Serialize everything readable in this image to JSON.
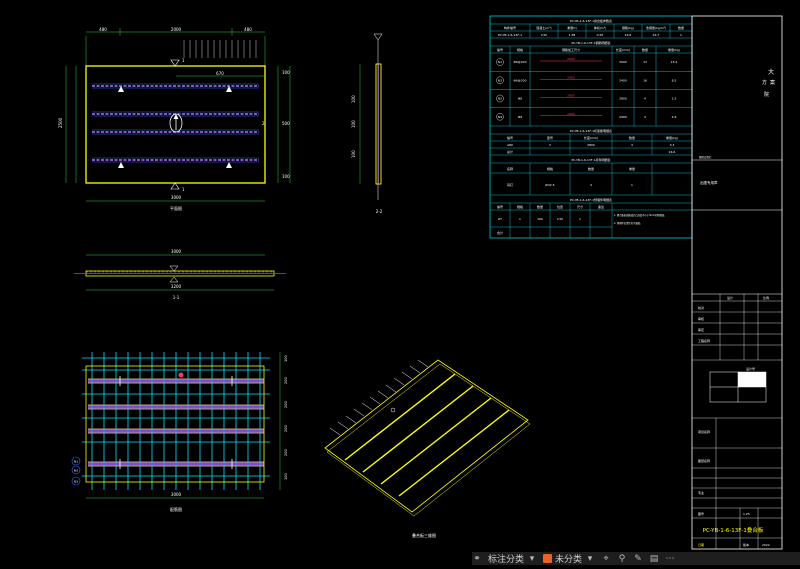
{
  "drawing": {
    "plan_title": "平面图",
    "plan_dims_top": [
      "480",
      "2000",
      "480"
    ],
    "plan_dim_inner": "670",
    "plan_dim_bottom": "3000",
    "plan_dim_right": [
      "100",
      "500",
      "100"
    ],
    "plan_dim_left": "2500",
    "section_1": "1",
    "section_2": "2",
    "side_title": "2-2",
    "side_dims": [
      "100",
      "100",
      "100"
    ],
    "elev_dim_top": "3000",
    "elev_dim_bottom": "3200",
    "elev_title": "1-1",
    "rebar_title": "配筋图",
    "rebar_dim_bottom": "3000",
    "rebar_dims_right": [
      "100",
      "200",
      "200",
      "200",
      "200",
      "100"
    ],
    "rebar_markers": [
      "N1",
      "N2",
      "N3"
    ],
    "rebar_tag": "N4",
    "iso_title": "叠合板三维图"
  },
  "schedule": {
    "t1_title": "PC-YB-1-6-13F-1叠合板参数表",
    "t1_headers": [
      "构件编号",
      "混凝土(m³)",
      "重量(t)",
      "体积(m³)",
      "钢筋(kg)",
      "含钢量(kg/m³)",
      "数量"
    ],
    "t1_row": [
      "PC-YB-1-6-13F-1",
      "C30",
      "1.38",
      "0.55",
      "24.6",
      "44.7",
      "1"
    ],
    "t2_title": "PC-YB-1-6-13F-1钢筋明细表",
    "t2_headers": [
      "编号",
      "规格",
      "钢筋加工尺寸",
      "长度(mm)",
      "数量",
      "重量(kg)"
    ],
    "t2_rows": [
      {
        "no": "N1",
        "spec": "Φ8@200",
        "dim": "2900",
        "len": "3000",
        "qty": "13",
        "wt": "15.4"
      },
      {
        "no": "N2",
        "spec": "Φ6@200",
        "dim": "2400",
        "len": "2400",
        "qty": "16",
        "wt": "8.5"
      },
      {
        "no": "N3",
        "spec": "Φ6",
        "dim": "2800",
        "len": "2800",
        "qty": "4",
        "wt": "2.5"
      },
      {
        "no": "N4",
        "spec": "Φ8",
        "dim": "2900",
        "len": "2900",
        "qty": "4",
        "wt": "4.6"
      }
    ],
    "t3_title": "PC-YB-1-6-13F-1桁架筋明细表",
    "t3_headers": [
      "编号",
      "型号",
      "长度(mm)",
      "数量",
      "重量(kg)"
    ],
    "t3_rows": [
      [
        "A80",
        "3",
        "2800",
        "3",
        "3.3"
      ],
      [
        "总计",
        "",
        "",
        "",
        "24.6"
      ]
    ],
    "t4_title": "PC-YB-1-6-13F-1吊件明细表",
    "t4_headers": [
      "名称",
      "规格",
      "数量",
      "重量"
    ],
    "t4_row": [
      "吊钉",
      "RD2.5",
      "4",
      "1"
    ],
    "t5_title": "PC-YB-1-6-13F-1预埋件明细表",
    "t5_headers": [
      "编号",
      "规格",
      "数量",
      "位置",
      "尺寸",
      "备注"
    ],
    "t5_rows": [
      [
        "ZT",
        "1",
        "100",
        "C30",
        "1",
        "1. 叠合板表面做成凹凸深度不小于4mm的粗糙面。"
      ],
      [
        "合计",
        "",
        "",
        "",
        "",
        "2. 预埋件位置详见平面图。"
      ]
    ]
  },
  "titleblock": {
    "company_lines": [
      "大",
      "方",
      "案",
      "院"
    ],
    "note": "图纸会签栏",
    "stamp": "出图专用章",
    "rows": [
      "设计",
      "校对",
      "审核",
      "审定",
      "工程名称",
      "项目名称",
      "图纸名称",
      "专业"
    ],
    "right_label": "设计号",
    "small_label": "比例",
    "cell_design": "1:25",
    "main_title": "PC-YB-1-6-13F-1叠合板",
    "date_label": "日期",
    "date_val": "2022",
    "sheet_label": "图号",
    "version": "版本"
  },
  "taskbar": {
    "label1": "标注分类",
    "label2": "未分类"
  },
  "colors": {
    "yellow": "#ffff00",
    "cyan": "#00e5ff",
    "blue": "#3a6bff",
    "purple": "#b070ff",
    "white": "#ffffff",
    "green": "#2bd14a"
  }
}
